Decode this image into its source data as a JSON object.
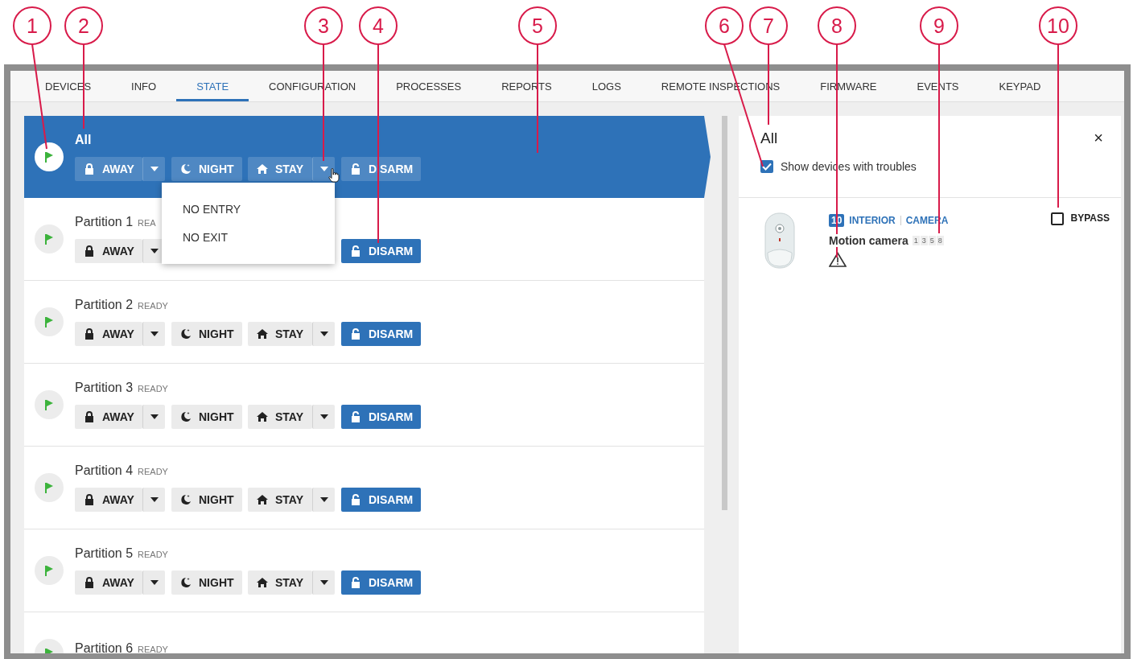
{
  "callouts": [
    "1",
    "2",
    "3",
    "4",
    "5",
    "6",
    "7",
    "8",
    "9",
    "10"
  ],
  "tabs": [
    {
      "label": "DEVICES",
      "selected": false
    },
    {
      "label": "INFO",
      "selected": false
    },
    {
      "label": "STATE",
      "selected": true
    },
    {
      "label": "CONFIGURATION",
      "selected": false
    },
    {
      "label": "PROCESSES",
      "selected": false
    },
    {
      "label": "REPORTS",
      "selected": false
    },
    {
      "label": "LOGS",
      "selected": false
    },
    {
      "label": "REMOTE INSPECTIONS",
      "selected": false
    },
    {
      "label": "FIRMWARE",
      "selected": false
    },
    {
      "label": "EVENTS",
      "selected": false
    },
    {
      "label": "KEYPAD",
      "selected": false
    }
  ],
  "partitions": [
    {
      "name": "All",
      "selected": true,
      "buttons": [
        {
          "kind": "away",
          "label": "AWAY",
          "dropdown": true,
          "active": false
        },
        {
          "kind": "night",
          "label": "NIGHT",
          "dropdown": false,
          "active": false
        },
        {
          "kind": "stay",
          "label": "STAY",
          "dropdown": true,
          "active": false,
          "menu": [
            "NO ENTRY",
            "NO EXIT"
          ]
        },
        {
          "kind": "disarm",
          "label": "DISARM",
          "dropdown": false,
          "active": false
        }
      ]
    },
    {
      "name": "Partition 1",
      "status": "REA",
      "selected": false,
      "buttons": [
        {
          "kind": "away",
          "label": "AWAY",
          "dropdown": true,
          "active": false
        },
        {
          "kind": "disarm",
          "label": "DISARM",
          "dropdown": false,
          "active": true
        }
      ]
    },
    {
      "name": "Partition 2",
      "status": "READY",
      "selected": false,
      "buttons": [
        {
          "kind": "away",
          "label": "AWAY",
          "dropdown": true,
          "active": false
        },
        {
          "kind": "night",
          "label": "NIGHT",
          "dropdown": false,
          "active": false
        },
        {
          "kind": "stay",
          "label": "STAY",
          "dropdown": true,
          "active": false
        },
        {
          "kind": "disarm",
          "label": "DISARM",
          "dropdown": false,
          "active": true
        }
      ]
    },
    {
      "name": "Partition 3",
      "status": "READY",
      "selected": false,
      "buttons": [
        {
          "kind": "away",
          "label": "AWAY",
          "dropdown": true,
          "active": false
        },
        {
          "kind": "night",
          "label": "NIGHT",
          "dropdown": false,
          "active": false
        },
        {
          "kind": "stay",
          "label": "STAY",
          "dropdown": true,
          "active": false
        },
        {
          "kind": "disarm",
          "label": "DISARM",
          "dropdown": false,
          "active": true
        }
      ]
    },
    {
      "name": "Partition 4",
      "status": "READY",
      "selected": false,
      "buttons": [
        {
          "kind": "away",
          "label": "AWAY",
          "dropdown": true,
          "active": false
        },
        {
          "kind": "night",
          "label": "NIGHT",
          "dropdown": false,
          "active": false
        },
        {
          "kind": "stay",
          "label": "STAY",
          "dropdown": true,
          "active": false
        },
        {
          "kind": "disarm",
          "label": "DISARM",
          "dropdown": false,
          "active": true
        }
      ]
    },
    {
      "name": "Partition 5",
      "status": "READY",
      "selected": false,
      "buttons": [
        {
          "kind": "away",
          "label": "AWAY",
          "dropdown": true,
          "active": false
        },
        {
          "kind": "night",
          "label": "NIGHT",
          "dropdown": false,
          "active": false
        },
        {
          "kind": "stay",
          "label": "STAY",
          "dropdown": true,
          "active": false
        },
        {
          "kind": "disarm",
          "label": "DISARM",
          "dropdown": false,
          "active": true
        }
      ]
    },
    {
      "name": "Partition 6",
      "status": "READY",
      "selected": false
    }
  ],
  "details": {
    "title": "All",
    "close": "×",
    "show_troubles": {
      "label": "Show devices with troubles",
      "checked": true
    },
    "devices": [
      {
        "number": "10",
        "zone": "INTERIOR",
        "type": "CAMERA",
        "name": "Motion camera",
        "partitions": [
          "1",
          "3",
          "5",
          "8"
        ],
        "trouble": true,
        "bypass": {
          "label": "BYPASS",
          "checked": false
        }
      }
    ]
  }
}
